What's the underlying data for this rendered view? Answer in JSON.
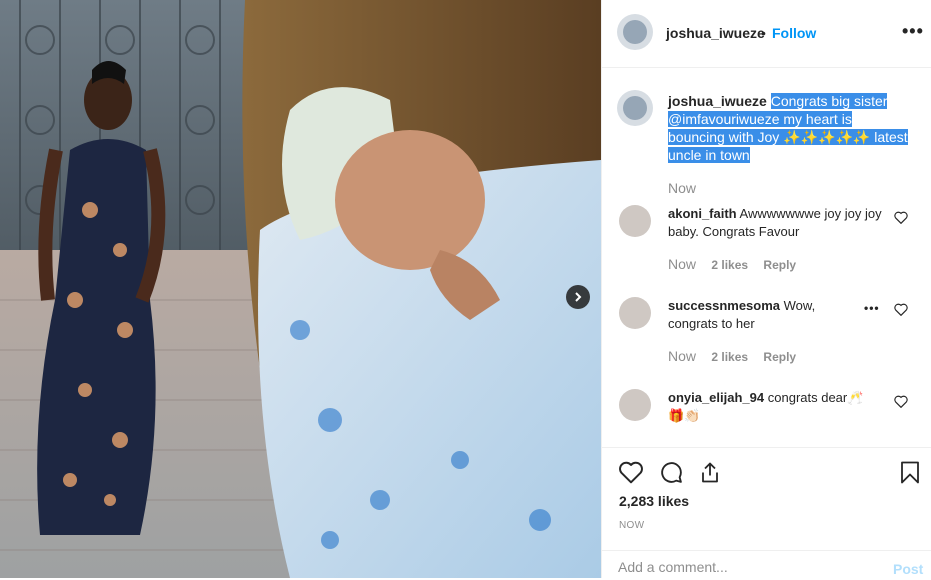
{
  "post": {
    "username": "joshua_iwueze",
    "follow_separator": "•",
    "follow_label": "Follow",
    "more_label": "•••",
    "caption": {
      "username": "joshua_iwueze",
      "text": "Congrats big sister @imfavouriwueze my heart is bouncing with Joy ✨✨✨✨✨ latest uncle in town",
      "time": "Now"
    },
    "comments": [
      {
        "username": "akoni_faith",
        "text": "Awwwwwwwe joy joy joy baby. Congrats Favour",
        "time": "Now",
        "likes": "2 likes",
        "reply": "Reply"
      },
      {
        "username": "successnmesoma",
        "text": "Wow, congrats to her",
        "time": "Now",
        "likes": "2 likes",
        "reply": "Reply"
      },
      {
        "username": "onyia_elijah_94",
        "text": "congrats dear🥂 🎁👏🏻",
        "time": "",
        "likes": "",
        "reply": ""
      }
    ],
    "likes": "2,283 likes",
    "timestamp": "NOW",
    "add_comment_placeholder": "Add a comment...",
    "post_label": "Post"
  },
  "icons": {
    "next": "chevron-right-icon",
    "like": "heart-icon",
    "comment": "comment-icon",
    "share": "share-icon",
    "save": "bookmark-icon"
  },
  "colors": {
    "link": "#0095f6",
    "highlight": "#3a8ee8",
    "muted": "#8e8e8e"
  }
}
